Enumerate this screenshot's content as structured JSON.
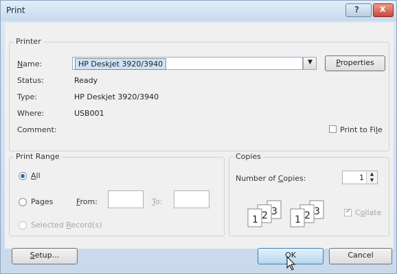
{
  "window": {
    "title": "Print",
    "help_label": "?",
    "close_label": "x"
  },
  "printer": {
    "group_title": "Printer",
    "name_label_pre": "",
    "name_label_u": "N",
    "name_label_post": "ame:",
    "name_value": "HP Deskjet 3920/3940",
    "status_label": "Status:",
    "status_value": "Ready",
    "type_label": "Type:",
    "type_value": "HP Deskjet 3920/3940",
    "where_label": "Where:",
    "where_value": "USB001",
    "comment_label": "Comment:",
    "comment_value": "",
    "properties_u": "P",
    "properties_post": "roperties",
    "print_to_file_pre": "Print to Fi",
    "print_to_file_u": "l",
    "print_to_file_post": "e",
    "print_to_file_checked": false
  },
  "print_range": {
    "group_title": "Print Range",
    "all_u": "A",
    "all_post": "ll",
    "pages_pre": "Pa",
    "pages_u": "g",
    "pages_post": "es",
    "from_u": "F",
    "from_post": "rom:",
    "from_value": "",
    "to_u": "T",
    "to_post": "o:",
    "to_value": "",
    "selected_pre": "Selected ",
    "selected_u": "R",
    "selected_post": "ecord(s)",
    "selected_option": "All"
  },
  "copies": {
    "group_title": "Copies",
    "number_pre": "Number of ",
    "number_u": "C",
    "number_post": "opies:",
    "number_value": "1",
    "collate_pre": "C",
    "collate_u": "o",
    "collate_post": "llate",
    "collate_checked": true,
    "collate_enabled": false,
    "page_digits": [
      "1",
      "2",
      "3"
    ]
  },
  "buttons": {
    "setup_u": "S",
    "setup_post": "etup...",
    "ok_label": "OK",
    "cancel_label": "Cancel"
  }
}
